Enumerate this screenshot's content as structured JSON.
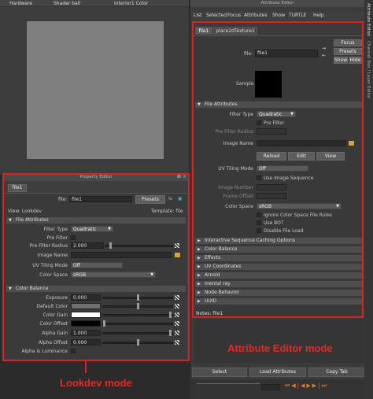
{
  "viewport": {
    "menu": [
      "Hardware",
      "Shader ball",
      "Interior1 Color"
    ]
  },
  "property_editor": {
    "title": "Property Editor",
    "tab": "file1",
    "file_label": "file:",
    "file_value": "file1",
    "presets_label": "Presets",
    "view_label": "View: Lookdev",
    "template_label": "Template: file",
    "section_file_attributes": "File Attributes",
    "filter_type_label": "Filter Type",
    "filter_type_value": "Quadratic",
    "pre_filter_label": "Pre Filter",
    "pre_filter_radius_label": "Pre Filter Radius",
    "pre_filter_radius_value": "2.000",
    "image_name_label": "Image Name",
    "uv_tiling_label": "UV Tiling Mode",
    "uv_tiling_value": "Off",
    "color_space_label": "Color Space",
    "color_space_value": "sRGB",
    "section_color_balance": "Color Balance",
    "exposure_label": "Exposure",
    "exposure_value": "0.000",
    "default_color_label": "Default Color",
    "color_gain_label": "Color Gain",
    "color_offset_label": "Color Offset",
    "alpha_gain_label": "Alpha Gain",
    "alpha_gain_value": "1.000",
    "alpha_offset_label": "Alpha Offset",
    "alpha_offset_value": "0.000",
    "alpha_is_luminance_label": "Alpha Is Luminance"
  },
  "attribute_editor": {
    "title": "Attribute Editor",
    "menu": [
      "List",
      "Selected",
      "Focus",
      "Attributes",
      "Show",
      "TURTLE",
      "Help"
    ],
    "tabs": [
      "file1",
      "place2dTexture1"
    ],
    "file_label": "file:",
    "file_value": "file1",
    "focus_label": "Focus",
    "presets_label": "Presets",
    "show_label": "Show",
    "hide_label": "Hide",
    "sample_label": "Sample",
    "section_file_attributes": "File Attributes",
    "filter_type_label": "Filter Type",
    "filter_type_value": "Quadratic",
    "pre_filter_label": "Pre Filter",
    "pre_filter_radius_label": "Pre Filter Radius",
    "image_name_label": "Image Name",
    "reload_label": "Reload",
    "edit_label": "Edit",
    "view_label": "View",
    "uv_tiling_label": "UV Tiling Mode",
    "uv_tiling_value": "Off",
    "use_image_sequence_label": "Use Image Sequence",
    "image_number_label": "Image Number",
    "frame_offset_label": "Frame Offset",
    "color_space_label": "Color Space",
    "color_space_value": "sRGB",
    "ignore_color_space_label": "Ignore Color Space File Rules",
    "use_bot_label": "Use BOT",
    "disable_file_load_label": "Disable File Load",
    "collapsed_sections": [
      "Interactive Sequence Caching Options",
      "Color Balance",
      "Effects",
      "UV Coordinates",
      "Arnold",
      "mental ray",
      "Node Behavior",
      "UUID"
    ],
    "notes_label": "Notes: file1",
    "select_label": "Select",
    "load_attributes_label": "Load Attributes",
    "copy_tab_label": "Copy Tab"
  },
  "side_strip": {
    "labels": [
      "Attribute Editor",
      "Channel Box / Layer Editor"
    ]
  },
  "annotations": {
    "lookdev_caption": "Lookdev mode",
    "attribute_caption": "Attribute Editor mode",
    "highlight_color": "#d92323"
  }
}
